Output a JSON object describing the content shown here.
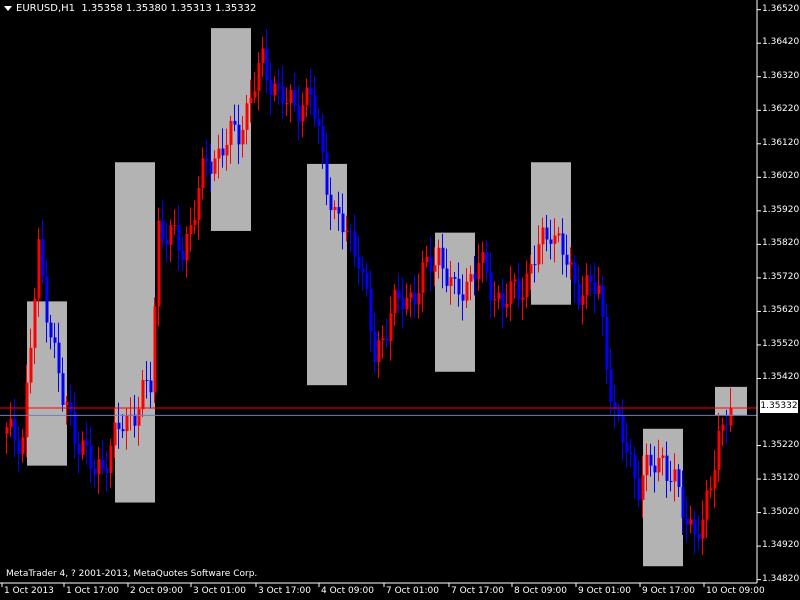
{
  "header": {
    "symbol": "EURUSD,H1",
    "quote": "1.35358 1.35380 1.35313 1.35332"
  },
  "footer": {
    "copyright": "MetaTrader 4, ? 2001-2013, MetaQuotes Software Corp."
  },
  "price_tag": "1.35332",
  "colors": {
    "background": "#000000",
    "bull": "#ff0000",
    "bear": "#0000ff",
    "box": "#b3b3b3",
    "axis": "#ffffff",
    "bid_line": "#ff0000",
    "ask_line": "#6a7fbf"
  },
  "chart_data": {
    "type": "candlestick",
    "timeframe": "H1",
    "y_ticks": [
      "1.36520",
      "1.36420",
      "1.36320",
      "1.36220",
      "1.36120",
      "1.36020",
      "1.35920",
      "1.35820",
      "1.35720",
      "1.35620",
      "1.35520",
      "1.35420",
      "1.35220",
      "1.35120",
      "1.35020",
      "1.34920",
      "1.34820"
    ],
    "x_ticks": [
      "1 Oct 2013",
      "1 Oct 17:00",
      "2 Oct 09:00",
      "3 Oct 01:00",
      "3 Oct 17:00",
      "4 Oct 09:00",
      "7 Oct 01:00",
      "7 Oct 17:00",
      "8 Oct 09:00",
      "9 Oct 01:00",
      "9 Oct 17:00",
      "10 Oct 09:00"
    ],
    "ylim": [
      1.3481,
      1.36525
    ],
    "current_bid": 1.35332,
    "current_ask": 1.3531,
    "boxes": [
      {
        "from": "1 Oct 06:00",
        "to": "1 Oct 15:00",
        "high": 1.3565,
        "low": 1.3516
      },
      {
        "from": "2 Oct 04:00",
        "to": "2 Oct 13:00",
        "high": 1.36065,
        "low": 1.3505
      },
      {
        "from": "3 Oct 04:00",
        "to": "3 Oct 13:00",
        "high": 1.36465,
        "low": 1.3586
      },
      {
        "from": "4 Oct 04:00",
        "to": "4 Oct 13:00",
        "high": 1.3606,
        "low": 1.354
      },
      {
        "from": "7 Oct 12:00",
        "to": "7 Oct 21:00",
        "high": 1.35855,
        "low": 1.3544
      },
      {
        "from": "8 Oct 12:00",
        "to": "8 Oct 21:00",
        "high": 1.36065,
        "low": 1.3564
      },
      {
        "from": "9 Oct 16:00",
        "to": "10 Oct 01:00",
        "high": 1.3527,
        "low": 1.3486
      },
      {
        "from": "10 Oct 10:00",
        "to": "10 Oct 17:00",
        "high": 1.35395,
        "low": 1.3531
      }
    ],
    "anchors": [
      {
        "bar": 0,
        "price": 1.3525
      },
      {
        "bar": 4,
        "price": 1.3525
      },
      {
        "bar": 8,
        "price": 1.3579
      },
      {
        "bar": 14,
        "price": 1.3535
      },
      {
        "bar": 22,
        "price": 1.3513
      },
      {
        "bar": 28,
        "price": 1.3526
      },
      {
        "bar": 36,
        "price": 1.354
      },
      {
        "bar": 38,
        "price": 1.3588
      },
      {
        "bar": 44,
        "price": 1.358
      },
      {
        "bar": 50,
        "price": 1.3606
      },
      {
        "bar": 58,
        "price": 1.3616
      },
      {
        "bar": 64,
        "price": 1.3636
      },
      {
        "bar": 70,
        "price": 1.3623
      },
      {
        "bar": 76,
        "price": 1.3626
      },
      {
        "bar": 82,
        "price": 1.359
      },
      {
        "bar": 88,
        "price": 1.358
      },
      {
        "bar": 92,
        "price": 1.3548
      },
      {
        "bar": 96,
        "price": 1.3562
      },
      {
        "bar": 102,
        "price": 1.3568
      },
      {
        "bar": 108,
        "price": 1.358
      },
      {
        "bar": 112,
        "price": 1.3566
      },
      {
        "bar": 118,
        "price": 1.3576
      },
      {
        "bar": 124,
        "price": 1.3564
      },
      {
        "bar": 130,
        "price": 1.3572
      },
      {
        "bar": 136,
        "price": 1.3588
      },
      {
        "bar": 142,
        "price": 1.357
      },
      {
        "bar": 148,
        "price": 1.3568
      },
      {
        "bar": 152,
        "price": 1.353
      },
      {
        "bar": 158,
        "price": 1.3511
      },
      {
        "bar": 164,
        "price": 1.3519
      },
      {
        "bar": 170,
        "price": 1.35
      },
      {
        "bar": 174,
        "price": 1.3496
      },
      {
        "bar": 178,
        "price": 1.3526
      },
      {
        "bar": 181,
        "price": 1.35332
      }
    ]
  }
}
